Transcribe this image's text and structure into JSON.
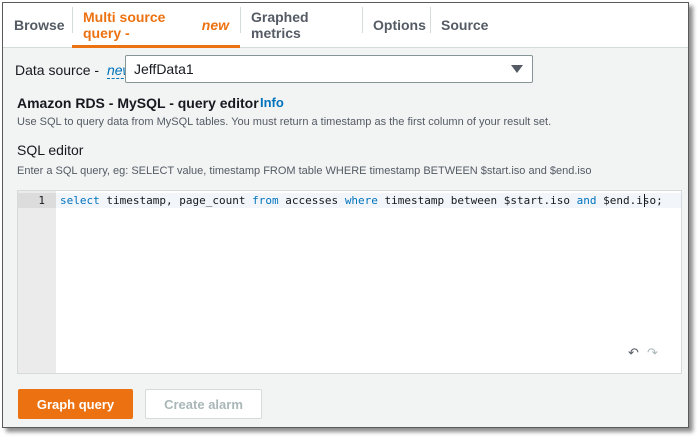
{
  "tabs": {
    "browse": "Browse",
    "multi_source": "Multi source query - ",
    "multi_source_new": "new",
    "graphed_metrics": "Graphed metrics",
    "options": "Options",
    "source": "Source"
  },
  "data_source": {
    "label": "Data source - ",
    "new_label": "new",
    "selected": "JeffData1"
  },
  "editor": {
    "title": "Amazon RDS - MySQL - query editor",
    "info_link": "Info",
    "description": "Use SQL to query data from MySQL tables. You must return a timestamp as the first column of your result set.",
    "sql_label": "SQL editor",
    "sql_hint": "Enter a SQL query, eg: SELECT value, timestamp FROM table WHERE timestamp BETWEEN $start.iso and $end.iso",
    "line_number": "1",
    "code": {
      "t1": "select",
      "t2": " timestamp, page_count ",
      "t3": "from",
      "t4": " accesses ",
      "t5": "where",
      "t6": " timestamp between $start.iso ",
      "t7": "and",
      "t8": " $end.iso;"
    },
    "undo_icon": "undo-icon",
    "redo_icon": "redo-icon"
  },
  "buttons": {
    "graph_query": "Graph query",
    "create_alarm": "Create alarm"
  },
  "colors": {
    "accent": "#ec7211",
    "link": "#0073bb"
  }
}
